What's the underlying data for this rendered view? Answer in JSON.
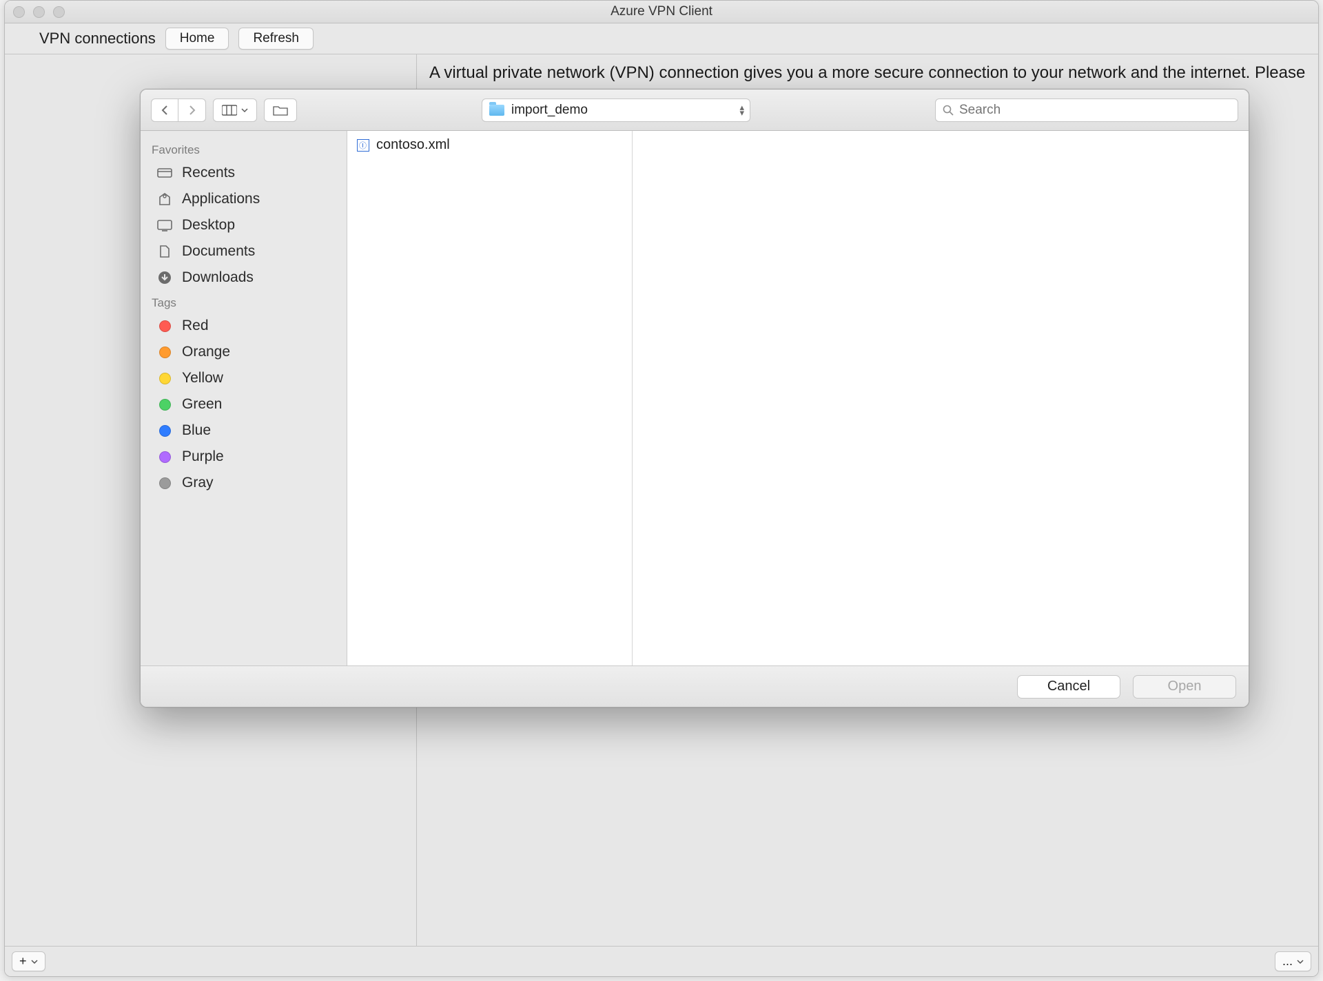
{
  "window": {
    "title": "Azure VPN Client"
  },
  "toolbar": {
    "connections_label": "VPN connections",
    "home_label": "Home",
    "refresh_label": "Refresh"
  },
  "main": {
    "intro": "A virtual private network (VPN) connection gives you a more secure connection to your network and the internet. Please create a new connection or select an existing connection to"
  },
  "bottombar": {
    "add_label": "+",
    "more_label": "..."
  },
  "file_dialog": {
    "current_folder": "import_demo",
    "search_placeholder": "Search",
    "sidebar": {
      "favorites_header": "Favorites",
      "favorites": [
        {
          "label": "Recents"
        },
        {
          "label": "Applications"
        },
        {
          "label": "Desktop"
        },
        {
          "label": "Documents"
        },
        {
          "label": "Downloads"
        }
      ],
      "tags_header": "Tags",
      "tags": [
        {
          "label": "Red",
          "color": "#ff5b52"
        },
        {
          "label": "Orange",
          "color": "#ff9b2f"
        },
        {
          "label": "Yellow",
          "color": "#ffd735"
        },
        {
          "label": "Green",
          "color": "#4cd265"
        },
        {
          "label": "Blue",
          "color": "#2f7dff"
        },
        {
          "label": "Purple",
          "color": "#b06bff"
        },
        {
          "label": "Gray",
          "color": "#9b9b9b"
        }
      ]
    },
    "files": [
      {
        "name": "contoso.xml"
      }
    ],
    "footer": {
      "cancel_label": "Cancel",
      "open_label": "Open"
    }
  }
}
